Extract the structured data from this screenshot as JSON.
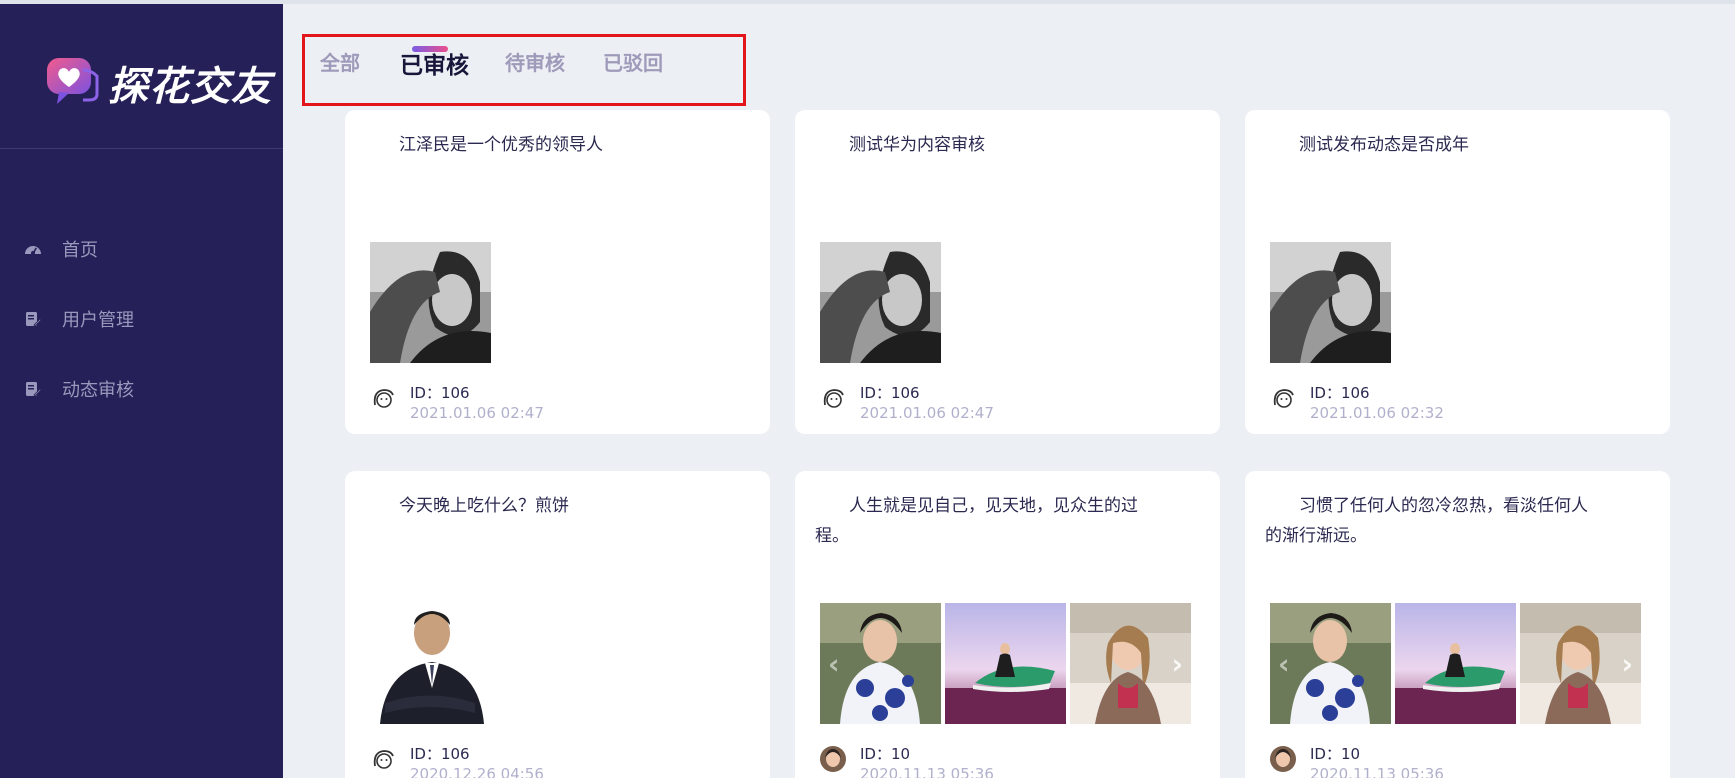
{
  "app": {
    "logo_text": "探花交友"
  },
  "sidebar": {
    "items": [
      {
        "label": "首页",
        "icon": "dashboard-icon"
      },
      {
        "label": "用户管理",
        "icon": "document-edit-icon"
      },
      {
        "label": "动态审核",
        "icon": "document-edit-icon"
      }
    ]
  },
  "tabs": [
    {
      "label": "全部",
      "active": false
    },
    {
      "label": "已审核",
      "active": true
    },
    {
      "label": "待审核",
      "active": false
    },
    {
      "label": "已驳回",
      "active": false
    }
  ],
  "posts": [
    {
      "text": "江泽民是一个优秀的领导人",
      "id_label": "ID：106",
      "time": "2021.01.06 02:47",
      "images": [
        "portrait-bw"
      ]
    },
    {
      "text": "测试华为内容审核",
      "id_label": "ID：106",
      "time": "2021.01.06 02:47",
      "images": [
        "portrait-bw"
      ]
    },
    {
      "text": "测试发布动态是否成年",
      "id_label": "ID：106",
      "time": "2021.01.06 02:32",
      "images": [
        "portrait-bw"
      ]
    },
    {
      "text": "今天晚上吃什么？煎饼",
      "id_label": "ID：106",
      "time": "2020.12.26 04:56",
      "images": [
        "portrait-suit"
      ]
    },
    {
      "text": "人生就是见自己，见天地，见众生的过程。",
      "id_label": "ID：10",
      "time": "2020.11.13 05:36",
      "images": [
        "photo-dress",
        "photo-jetski",
        "photo-restaurant"
      ]
    },
    {
      "text": "习惯了任何人的忽冷忽热，看淡任何人的渐行渐远。",
      "id_label": "ID：10",
      "time": "2020.11.13 05:36",
      "images": [
        "photo-dress",
        "photo-jetski",
        "photo-restaurant"
      ]
    }
  ],
  "colors": {
    "sidebar_bg": "#252158",
    "page_bg": "#eceff3",
    "highlight_border": "#e3151a",
    "tab_active": "#18163a",
    "tab_inactive": "#9d9aba"
  }
}
